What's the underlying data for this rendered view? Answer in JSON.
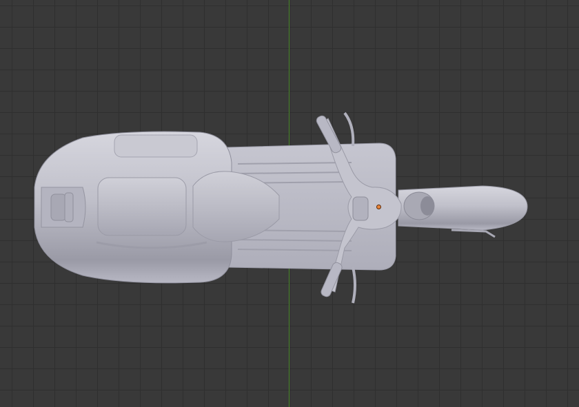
{
  "viewport": {
    "view": "top-orthographic",
    "background_color": "#393939",
    "grid_color": "#2f2f2f",
    "y_axis_color": "#4c8a2c",
    "origin_color": "#e8843a"
  },
  "model": {
    "object": "scooter-mesh",
    "shading": "solid-matcap",
    "base_color": "#b9b9c4"
  }
}
